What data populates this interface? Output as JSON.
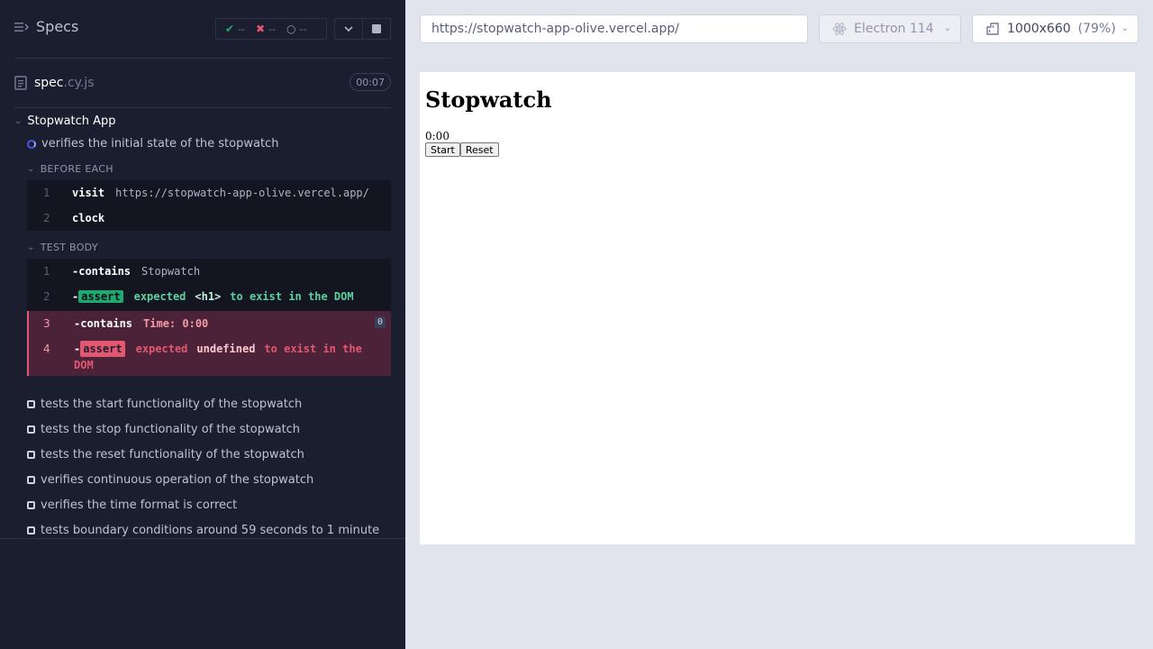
{
  "header": {
    "title": "Specs",
    "stats": {
      "passed": "--",
      "failed": "--",
      "pending": "--"
    }
  },
  "spec": {
    "name": "spec",
    "ext": ".cy.js",
    "duration": "00:07"
  },
  "suite": {
    "title": "Stopwatch App"
  },
  "running_test": {
    "title": "verifies the initial state of the stopwatch"
  },
  "before_each": {
    "title": "BEFORE EACH",
    "commands": [
      {
        "num": "1",
        "name": "visit",
        "msg": "https://stopwatch-app-olive.vercel.app/"
      },
      {
        "num": "2",
        "name": "clock",
        "msg": ""
      }
    ]
  },
  "test_body": {
    "title": "TEST BODY",
    "commands": [
      {
        "num": "1",
        "dash": "-",
        "name": "contains",
        "msg": "Stopwatch"
      },
      {
        "num": "2",
        "dash": "-",
        "badge": "assert",
        "w1": "expected",
        "w2": "<h1>",
        "w3": "to exist in the DOM"
      },
      {
        "num": "3",
        "dash": "-",
        "name": "contains",
        "msg": "Time: 0:00",
        "count": "0"
      },
      {
        "num": "4",
        "dash": "-",
        "badge": "assert",
        "w1": "expected",
        "w2": "undefined",
        "w3": "to exist in the",
        "w4": "DOM"
      }
    ]
  },
  "pending_tests": [
    "tests the start functionality of the stopwatch",
    "tests the stop functionality of the stopwatch",
    "tests the reset functionality of the stopwatch",
    "verifies continuous operation of the stopwatch",
    "verifies the time format is correct",
    "tests boundary conditions around 59 seconds to 1 minute"
  ],
  "toolbar": {
    "url": "https://stopwatch-app-olive.vercel.app/",
    "browser": "Electron 114",
    "viewport": "1000x660",
    "viewport_pct": "(79%)"
  },
  "app": {
    "heading": "Stopwatch",
    "time": "0:00",
    "start_label": "Start",
    "reset_label": "Reset"
  },
  "colors": {
    "sidebar_bg": "#1b1e2e",
    "pass": "#1fa971",
    "fail": "#e45770",
    "accent": "#4956e3"
  }
}
